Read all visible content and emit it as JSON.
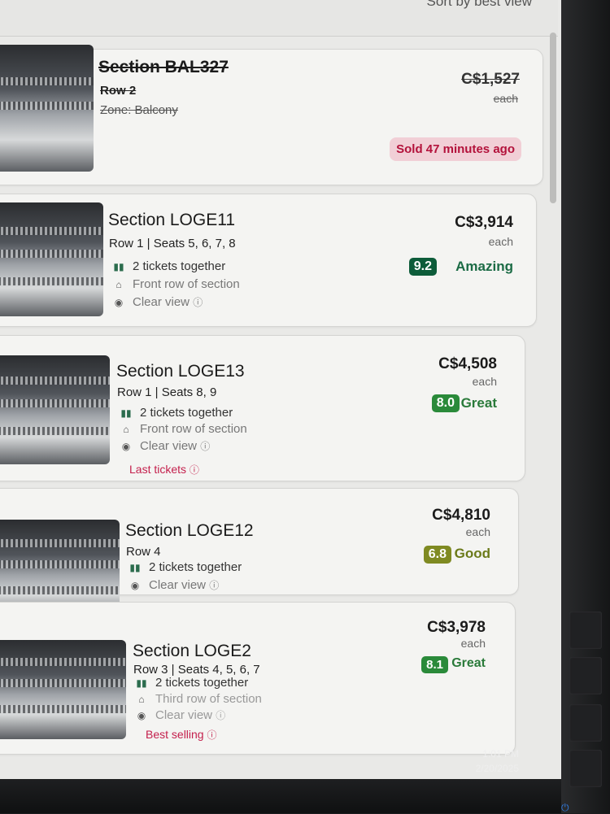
{
  "header": {
    "sort_label": "Sort by best view"
  },
  "listings": [
    {
      "section": "Section BAL327",
      "row": "Row 2",
      "zone": "Zone: Balcony",
      "price": "C$1,527",
      "each": "each",
      "sold_text": "Sold 47 minutes ago"
    },
    {
      "section": "Section LOGE11",
      "row": "Row 1 | Seats 5, 6, 7, 8",
      "features": [
        "2 tickets together",
        "Front row of section",
        "Clear view"
      ],
      "price": "C$3,914",
      "each": "each",
      "score": "9.2",
      "rating": "Amazing",
      "score_color": "#0d5c3a"
    },
    {
      "section": "Section LOGE13",
      "row": "Row 1 | Seats 8, 9",
      "features": [
        "2 tickets together",
        "Front row of section",
        "Clear view"
      ],
      "tag": "Last tickets",
      "price": "C$4,508",
      "each": "each",
      "score": "8.0",
      "rating": "Great",
      "score_color": "#2a8a3a"
    },
    {
      "section": "Section LOGE12",
      "row": "Row 4",
      "features": [
        "2 tickets together",
        "Clear view"
      ],
      "price": "C$4,810",
      "each": "each",
      "score": "6.8",
      "rating": "Good",
      "score_color": "#7f8a22"
    },
    {
      "section": "Section LOGE2",
      "row": "Row 3 | Seats 4, 5, 6, 7",
      "features": [
        "2 tickets together",
        "Third row of section",
        "Clear view"
      ],
      "tag": "Best selling",
      "price": "C$3,978",
      "each": "each",
      "score": "8.1",
      "rating": "Great",
      "score_color": "#2a8a3a"
    }
  ],
  "taskbar": {
    "time": "1:01 PM",
    "date": "2/20/2025"
  }
}
